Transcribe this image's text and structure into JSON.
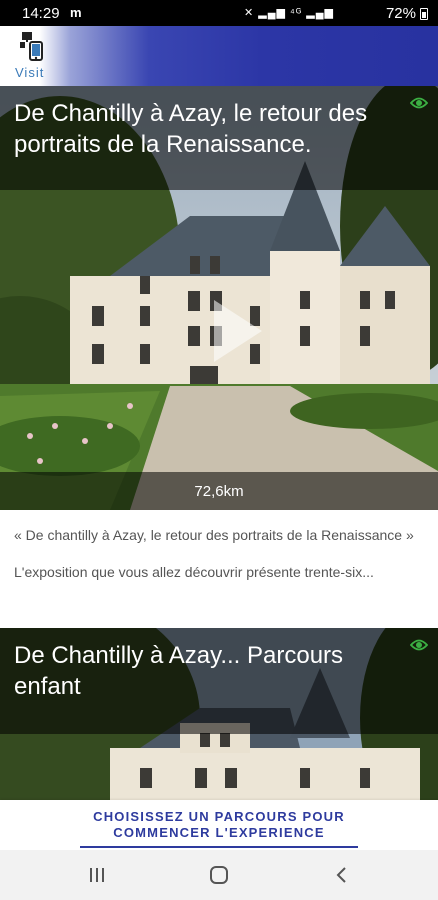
{
  "status_bar": {
    "time": "14:29",
    "carrier": "m",
    "signal_icons": "✕ ▂▄▆ ⁴ᴳ ▂▄▆",
    "battery": "72%"
  },
  "app_bar": {
    "logo_text": "Visit"
  },
  "cards": [
    {
      "title": "De Chantilly à Azay, le retour des portraits de la Renaissance.",
      "distance": "72,6km",
      "icon": "eye-icon"
    },
    {
      "title": "De Chantilly à Azay... Parcours enfant",
      "icon": "eye-icon"
    }
  ],
  "description": {
    "line1": "« De chantilly à Azay, le retour des portraits de la Renaissance »",
    "line2": "L'exposition que vous allez découvrir présente trente-six..."
  },
  "cta": {
    "label": "CHOISISSEZ UN PARCOURS POUR COMMENCER L'EXPERIENCE"
  },
  "colors": {
    "accent": "#2e3b9e",
    "eye_green": "#3cb043"
  },
  "nav": {
    "icons": [
      "recent-apps-icon",
      "home-icon",
      "back-icon"
    ]
  }
}
